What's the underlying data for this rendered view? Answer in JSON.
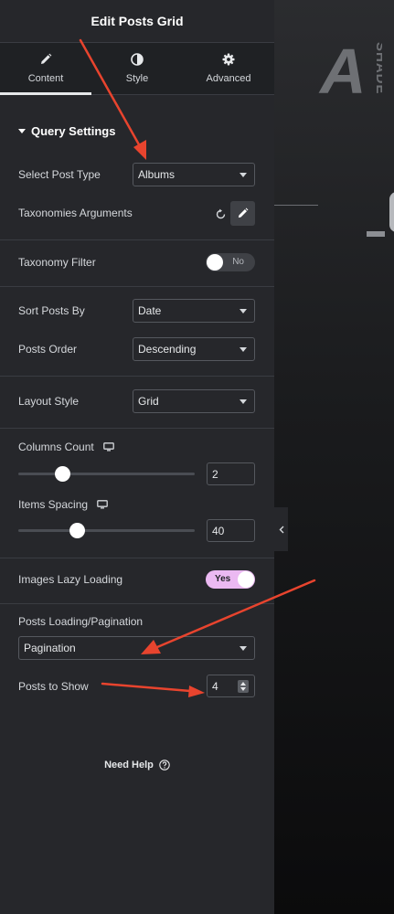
{
  "panel": {
    "title": "Edit Posts Grid",
    "tabs": [
      {
        "label": "Content",
        "icon": "pencil-icon",
        "active": true
      },
      {
        "label": "Style",
        "icon": "contrast-icon",
        "active": false
      },
      {
        "label": "Advanced",
        "icon": "gear-icon",
        "active": false
      }
    ],
    "section_title": "Query Settings",
    "fields": {
      "post_type": {
        "label": "Select Post Type",
        "value": "Albums"
      },
      "taxonomies": {
        "label": "Taxonomies Arguments"
      },
      "taxonomy_filter": {
        "label": "Taxonomy Filter",
        "state": "No"
      },
      "sort_by": {
        "label": "Sort Posts By",
        "value": "Date"
      },
      "order": {
        "label": "Posts Order",
        "value": "Descending"
      },
      "layout": {
        "label": "Layout Style",
        "value": "Grid"
      },
      "columns": {
        "label": "Columns Count",
        "value": "2",
        "slider_fraction": 0.25
      },
      "spacing": {
        "label": "Items Spacing",
        "value": "40",
        "slider_fraction": 0.33
      },
      "lazy": {
        "label": "Images Lazy Loading",
        "state": "Yes"
      },
      "pagination": {
        "label": "Posts Loading/Pagination",
        "value": "Pagination"
      },
      "posts_to_show": {
        "label": "Posts to Show",
        "value": "4"
      }
    },
    "need_help": "Need Help"
  },
  "preview": {
    "logo_letter": "A",
    "logo_word": "SHADE"
  },
  "colors": {
    "panel_bg": "#26272b",
    "toggle_on": "#ebb9f2",
    "annotation_arrow": "#e8442e"
  }
}
